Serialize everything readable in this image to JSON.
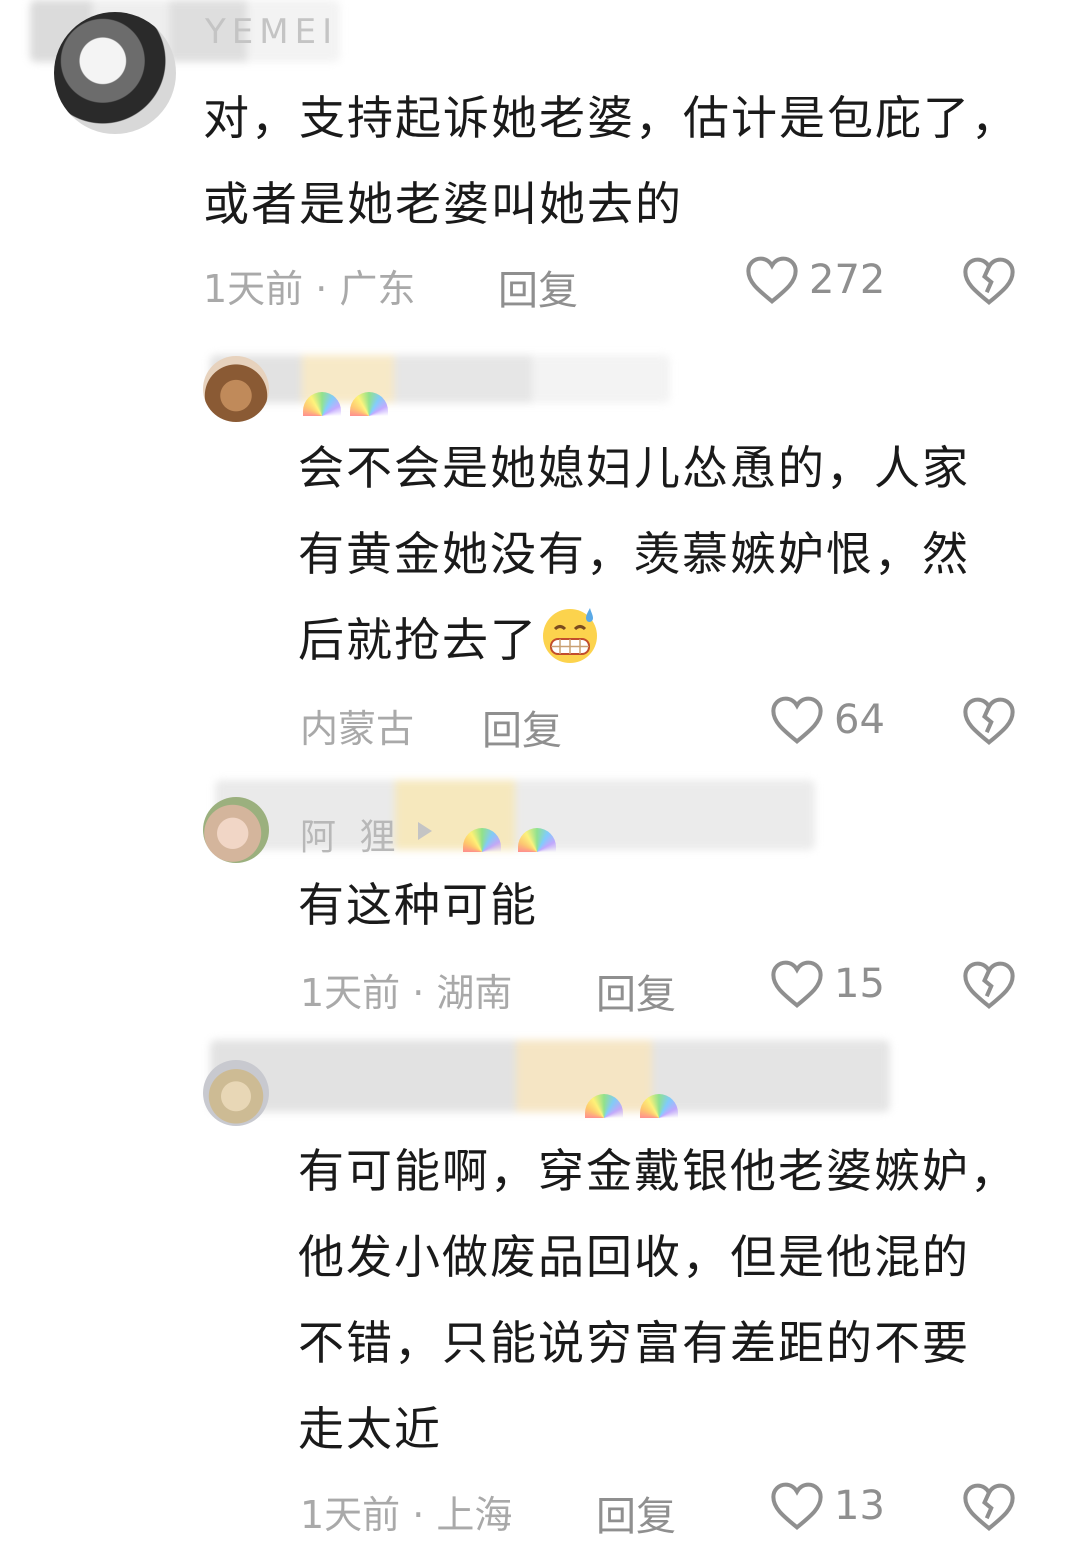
{
  "comments": [
    {
      "name": "YEMEI",
      "text": "对，支持起诉她老婆，估计是包庇了，\n或者是她老婆叫她去的",
      "meta": "1天前 · 广东",
      "reply": "回复",
      "likes": "272",
      "avatar": "avatar"
    },
    {
      "name": "",
      "text": "会不会是她媳妇儿怂恿的，人家\n有黄金她没有，羡慕嫉妒恨，然\n后就抢去了",
      "emoji": "grimacing-sweat-emoji",
      "meta": "内蒙古",
      "reply": "回复",
      "likes": "64",
      "avatar": "avatar"
    },
    {
      "name": "阿 狸",
      "text": "有这种可能",
      "meta": "1天前 · 湖南",
      "reply": "回复",
      "likes": "15",
      "avatar": "avatar"
    },
    {
      "name": "",
      "text": "有可能啊，穿金戴银他老婆嫉妒，\n他发小做废品回收，但是他混的\n不错，只能说穷富有差距的不要\n走太近",
      "meta": "1天前 · 上海",
      "reply": "回复",
      "likes": "13",
      "avatar": "avatar"
    }
  ],
  "colors": {
    "text": "#1a1a1a",
    "meta": "#a9a9a9",
    "action": "#8f8f8f"
  },
  "icons": {
    "like": "heart-outline-icon",
    "dislike": "broken-heart-icon"
  }
}
